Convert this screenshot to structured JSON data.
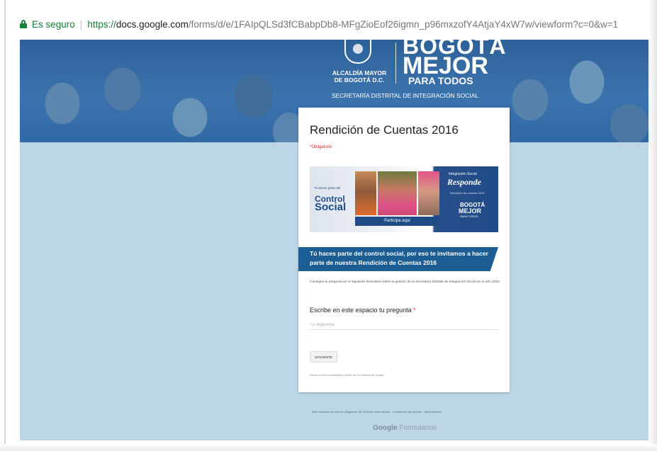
{
  "browser": {
    "secure_label": "Es seguro",
    "separator": "|",
    "url": {
      "scheme": "https://",
      "host": "docs.google.com",
      "path": "/forms/d/e/1FAIpQLSd3fCBabpDb8-MFgZioEof26igmn_p96mxzofY4AtjaY4xW7w/viewform?c=0&w=1"
    }
  },
  "banner": {
    "alcaldia": "ALCALDÍA MAYOR DE BOGOTÁ D.C.",
    "bogota": "BOGOTÁ",
    "mejor": "MEJOR",
    "para_todos": "PARA TODOS",
    "secretaria": "SECRETARÍA DISTRITAL DE INTEGRACIÓN SOCIAL"
  },
  "form": {
    "title": "Rendición de Cuentas 2016",
    "required_note": "*Obligatorio",
    "promo": {
      "small_text": "Tú haces parte del",
      "control": "Control",
      "social": "Social",
      "button": "Participa aquí",
      "integracion": "Integración Social",
      "responde": "Responde",
      "rendicion": "Rendición de cuentas 2016",
      "logo_bogota": "BOGOTÁ",
      "logo_mejor": "MEJOR",
      "logo_para_todos": "PARA TODOS"
    },
    "section_heading": "Tú haces parte del control social, por eso te invitamos a hacer parte de nuestra Rendición de Cuentas 2016",
    "description": "Consigna tu pregunta en el siguiente formulario sobre la gestión de la Secretaría Distrital de Integración Social en el año 2016",
    "question": {
      "label": "Escribe en este espacio tu pregunta",
      "required_mark": "*",
      "placeholder": "Tu respuesta"
    },
    "next_button": "SIGUIENTE",
    "never_submit": "Nunca envíes contraseñas a través de Formularios de Google."
  },
  "footer": {
    "note": "Este formulario se creó en Integración SE. Informar sobre abusos · Condiciones del servicio · Otros términos",
    "brand_google": "Google",
    "brand_product": "Formularios"
  },
  "colors": {
    "secure_green": "#188038",
    "page_background": "#bcd6e6",
    "ribbon_blue": "#1c5d93",
    "required_red": "#d93025"
  }
}
